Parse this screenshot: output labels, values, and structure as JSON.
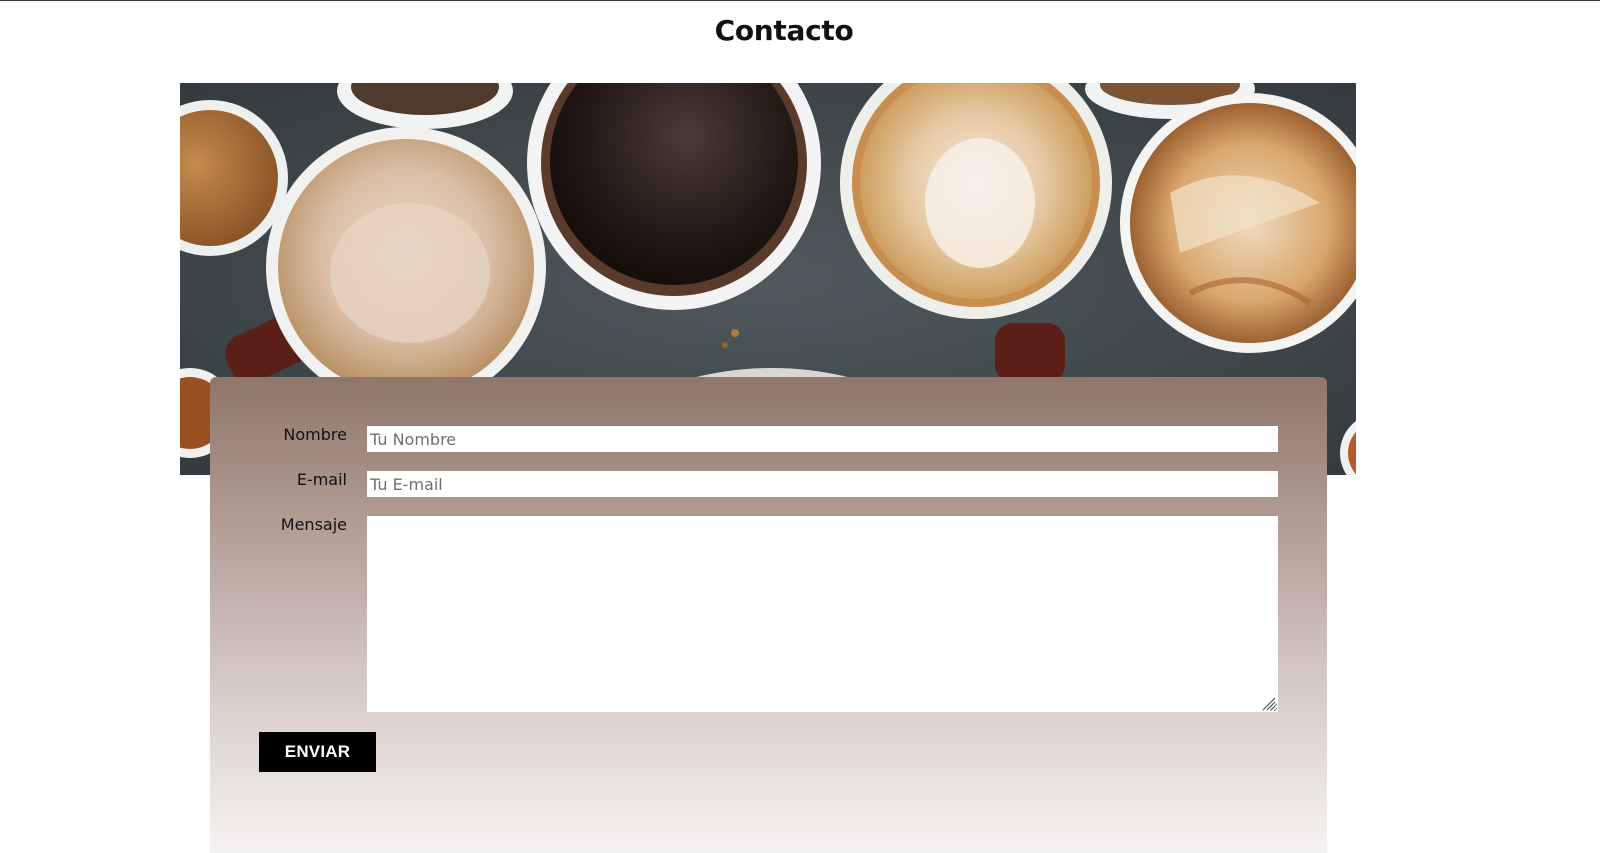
{
  "page": {
    "title": "Contacto"
  },
  "hero": {
    "image_icon": "coffee-cups-image"
  },
  "form": {
    "name_label": "Nombre",
    "name_placeholder": "Tu Nombre",
    "name_value": "",
    "email_label": "E-mail",
    "email_placeholder": "Tu E-mail",
    "email_value": "",
    "message_label": "Mensaje",
    "message_value": "",
    "submit_label": "ENVIAR"
  },
  "colors": {
    "card_gradient_top": "#8f766b",
    "card_gradient_bottom": "#f5f3f2",
    "button_bg": "#000000",
    "button_text": "#ffffff"
  }
}
